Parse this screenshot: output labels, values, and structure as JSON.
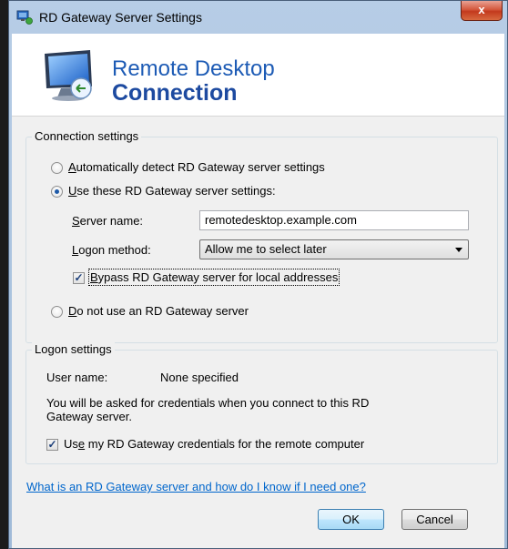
{
  "window": {
    "title": "RD Gateway Server Settings",
    "close_label": "x"
  },
  "banner": {
    "line1": "Remote Desktop",
    "line2": "Connection"
  },
  "connection_settings": {
    "group_title": "Connection settings",
    "auto_detect": {
      "accel": "A",
      "rest": "utomatically detect RD Gateway server settings",
      "checked": false
    },
    "use_these": {
      "accel": "U",
      "rest": "se these RD Gateway server settings:",
      "checked": true
    },
    "server_name": {
      "accel": "S",
      "rest": "erver name:",
      "value": "remotedesktop.example.com"
    },
    "logon_method": {
      "accel": "L",
      "rest": "ogon method:",
      "selected": "Allow me to select later"
    },
    "bypass": {
      "accel": "B",
      "rest": "ypass RD Gateway server for local addresses",
      "checked": true
    },
    "do_not_use": {
      "accel": "D",
      "rest": "o not use an RD Gateway server",
      "checked": false
    }
  },
  "logon_settings": {
    "group_title": "Logon settings",
    "user_name_label": "User name:",
    "user_name_value": "None specified",
    "info_line1": "You will be asked for credentials when you connect to this RD",
    "info_line2": "Gateway server.",
    "use_creds": {
      "pre": "Us",
      "accel": "e",
      "rest": " my RD Gateway credentials for the remote computer",
      "checked": true
    }
  },
  "help_link": "What is an RD Gateway server and how do I know if I need one?",
  "buttons": {
    "ok": "OK",
    "cancel": "Cancel"
  },
  "colors": {
    "link": "#0066cc",
    "banner_text": "#1d5bb5",
    "close_button": "#c3391d"
  }
}
